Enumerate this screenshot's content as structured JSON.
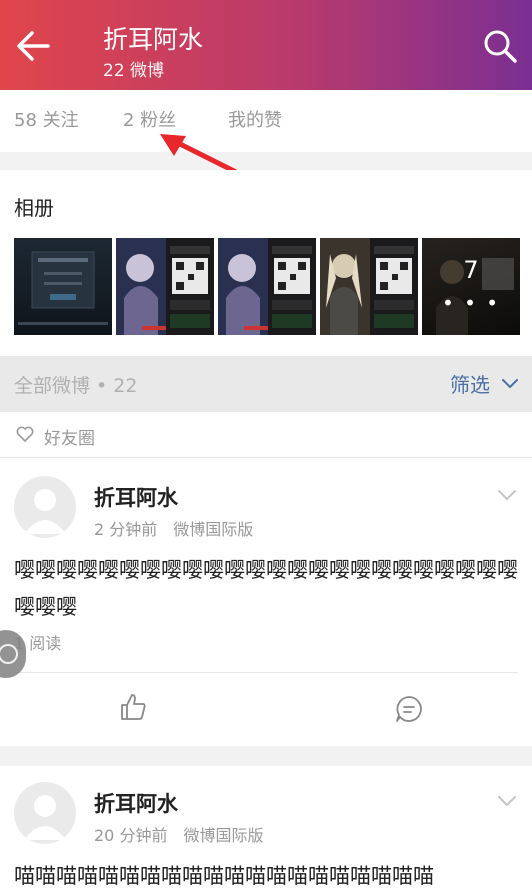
{
  "header": {
    "title": "折耳阿水",
    "subtitle": "22 微博"
  },
  "stats": {
    "following": "58 关注",
    "followers": "2 粉丝",
    "likes": "我的赞"
  },
  "album": {
    "title": "相册",
    "more_count": "7",
    "more_dots": "• • •"
  },
  "filter": {
    "label": "全部微博 • 22",
    "button": "筛选"
  },
  "friend_circle": {
    "label": "好友圈"
  },
  "posts": [
    {
      "name": "折耳阿水",
      "time": "2 分钟前",
      "source": "微博国际版",
      "content": "嘤嘤嘤嘤嘤嘤嘤嘤嘤嘤嘤嘤嘤嘤嘤嘤嘤嘤嘤嘤嘤嘤嘤嘤嘤嘤嘤",
      "reads": "1 阅读"
    },
    {
      "name": "折耳阿水",
      "time": "20 分钟前",
      "source": "微博国际版",
      "content": "喵喵喵喵喵喵喵喵喵喵喵喵喵喵喵喵喵喵喵喵"
    }
  ],
  "colors": {
    "header_start": "#e0454a",
    "header_end": "#7b2f93",
    "link": "#4a6fa5",
    "annotation_arrow": "#e8262b"
  }
}
